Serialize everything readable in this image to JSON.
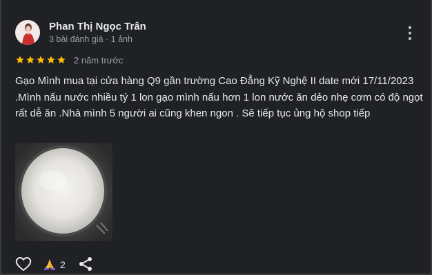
{
  "review": {
    "author_name": "Phan Thị Ngọc Trân",
    "author_meta": "3 bài đánh giá · 1 ảnh",
    "rating": 5,
    "time_ago": "2 năm trước",
    "text": "Gạo Mình mua tại cửa hàng Q9 gần trường Cao Đẳng Kỹ Nghệ II date mới 17/11/2023 .Mình nấu nước nhiều tý 1 lon gạo mình nấu hơn 1 lon nước ăn dẻo nhẹ cơm có độ ngọt rất dễ ăn .Nhà mình 5 người ai cũng khen ngon . Sẽ tiếp tục ủng hộ shop tiếp",
    "reaction_count": "2"
  },
  "icons": {
    "more": "more-vert-icon",
    "star": "star-icon",
    "like": "heart-outline-icon",
    "reaction": "praying-hands-icon",
    "share": "share-icon"
  },
  "colors": {
    "background": "#202124",
    "star": "#fbbc04",
    "text": "#e8eaed",
    "muted": "#9aa0a6"
  }
}
